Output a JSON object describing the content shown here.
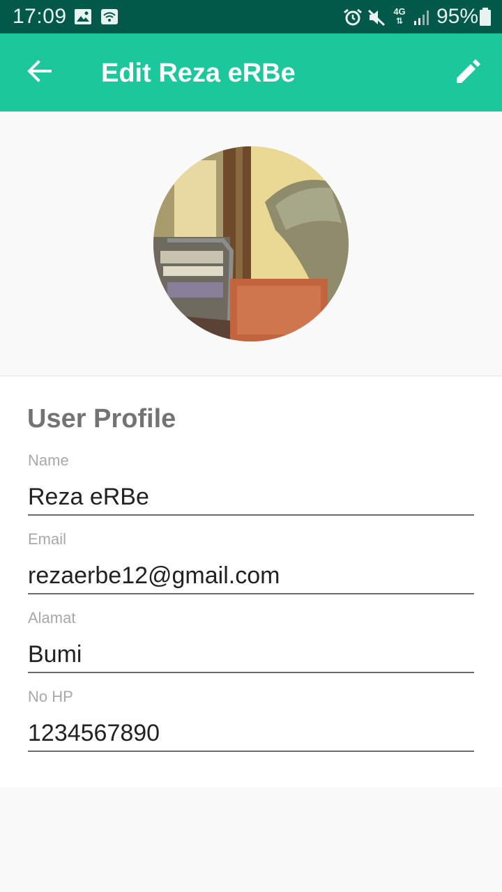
{
  "status_bar": {
    "time": "17:09",
    "battery": "95%",
    "network": "4G",
    "icons": [
      "image-icon",
      "wifi-icon",
      "alarm-icon",
      "mute-icon",
      "signal-icon",
      "battery-icon"
    ]
  },
  "app_bar": {
    "title": "Edit Reza eRBe",
    "back_icon": "arrow-left-icon",
    "edit_icon": "pencil-icon",
    "color": "#1bc79b"
  },
  "profile": {
    "section_title": "User Profile",
    "fields": [
      {
        "label": "Name",
        "value": "Reza eRBe"
      },
      {
        "label": "Email",
        "value": "rezaerbe12@gmail.com"
      },
      {
        "label": "Alamat",
        "value": "Bumi"
      },
      {
        "label": "No HP",
        "value": "1234567890"
      }
    ]
  }
}
